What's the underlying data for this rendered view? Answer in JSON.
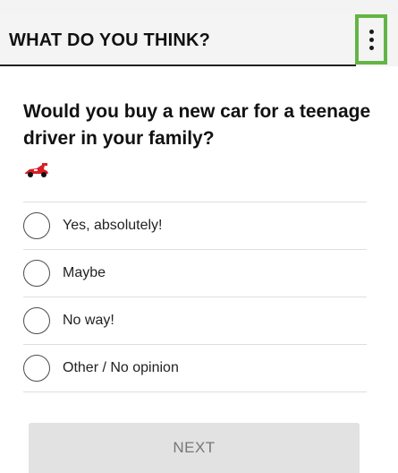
{
  "header": {
    "title": "WHAT DO YOU THINK?",
    "menu_icon": "more-vertical-icon",
    "menu_highlight_color": "#63b544"
  },
  "question": {
    "text": "Would you buy a new car for a teenage driver in your family?",
    "icon": "race-car-icon"
  },
  "options": [
    {
      "label": "Yes, absolutely!"
    },
    {
      "label": "Maybe"
    },
    {
      "label": "No way!"
    },
    {
      "label": "Other / No opinion"
    }
  ],
  "footer": {
    "next_label": "NEXT"
  }
}
